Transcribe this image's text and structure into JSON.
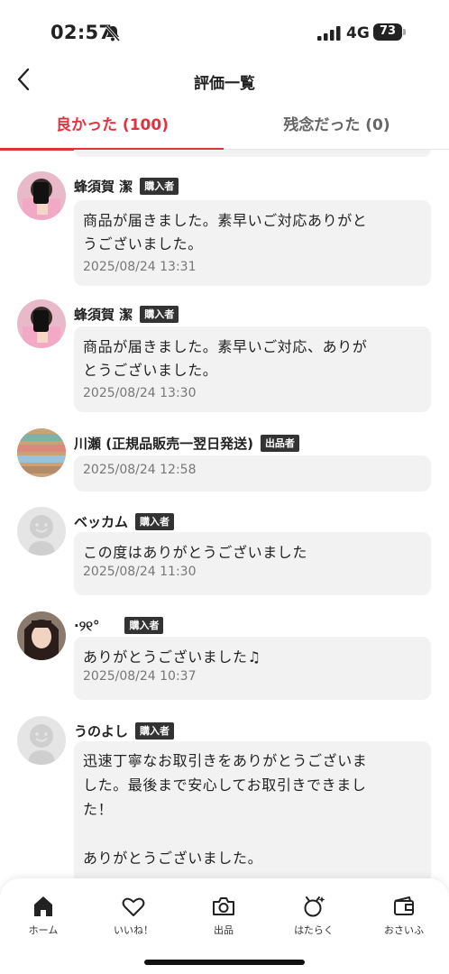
{
  "status": {
    "time": "02:57",
    "network": "4G",
    "battery": "73"
  },
  "header": {
    "title": "評価一覧"
  },
  "tabs": [
    {
      "label": "良かった (100)",
      "active": true
    },
    {
      "label": "残念だった (0)",
      "active": false
    }
  ],
  "reviews": [
    {
      "name": "蜂須賀 潔",
      "role": "購入者",
      "text": "商品が届きました。素早いご対応ありがと\nうございました。",
      "date": "2025/08/24 13:31",
      "avatar": "photo-phone"
    },
    {
      "name": "蜂須賀 潔",
      "role": "購入者",
      "text": "商品が届きました。素早いご対応、ありが\nとうございました。",
      "date": "2025/08/24 13:30",
      "avatar": "photo-phone"
    },
    {
      "name": "川瀬 (正規品販売一翌日発送)",
      "role": "出品者",
      "text": "",
      "date": "2025/08/24 12:58",
      "avatar": "photo-shelves"
    },
    {
      "name": "ベッカム",
      "role": "購入者",
      "text": "この度はありがとうございました",
      "date": "2025/08/24 11:30",
      "avatar": "default-face"
    },
    {
      "name": "·୨୧°",
      "role": "購入者",
      "text": "ありがとうございました♫",
      "date": "2025/08/24 10:37",
      "avatar": "photo-portrait"
    },
    {
      "name": "うのよし",
      "role": "購入者",
      "text": "迅速丁寧なお取引きをありがとうございま\nした。最後まで安心してお取引きできまし\nた！\n\nありがとうございました。",
      "date": "",
      "avatar": "default-face"
    }
  ],
  "bottom_nav": [
    {
      "label": "ホーム",
      "icon": "home-icon",
      "active": true
    },
    {
      "label": "いいね！",
      "icon": "heart-icon",
      "active": false
    },
    {
      "label": "出品",
      "icon": "camera-icon",
      "active": false
    },
    {
      "label": "はたらく",
      "icon": "sparkle-clock-icon",
      "active": false
    },
    {
      "label": "おさいふ",
      "icon": "wallet-icon",
      "active": false
    }
  ]
}
